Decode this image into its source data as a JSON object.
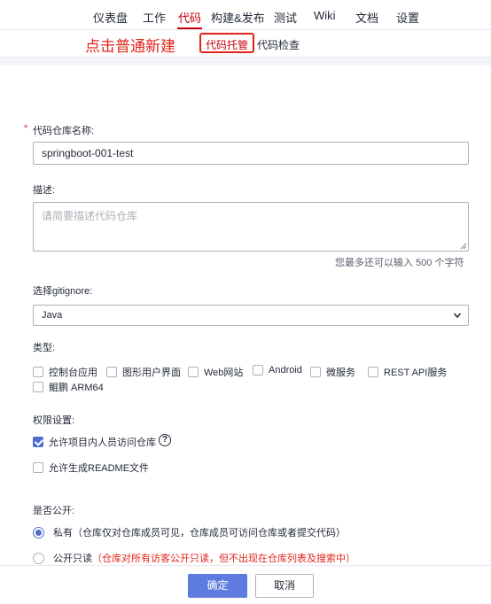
{
  "nav": {
    "items": [
      "仪表盘",
      "工作",
      "代码",
      "构建&发布",
      "测试",
      "Wiki",
      "文档",
      "设置"
    ],
    "active": "代码"
  },
  "annotation": "点击普通新建",
  "subnav": {
    "hosting": "代码托管",
    "check": "代码检查"
  },
  "form": {
    "name_label": "代码仓库名称:",
    "required_mark": "*",
    "name_value": "springboot-001-test",
    "desc_label": "描述:",
    "desc_placeholder": "请简要描述代码仓库",
    "desc_counter": "您最多还可以输入 500 个字符",
    "gitignore_label": "选择gitignore:",
    "gitignore_value": "Java",
    "type_label": "类型:",
    "types": [
      "控制台应用",
      "图形用户界面",
      "Web网站",
      "Android",
      "微服务",
      "REST API服务",
      "鲲鹏 ARM64"
    ],
    "perm_label": "权限设置:",
    "perm_allow_members": "允许项目内人员访问仓库",
    "perm_help": "?",
    "perm_readme": "允许生成README文件",
    "public_label": "是否公开:",
    "private_title": "私有",
    "private_desc": "（仓库仅对仓库成员可见，仓库成员可访问仓库或者提交代码）",
    "public_title": "公开只读",
    "public_desc": "（仓库对所有访客公开只读，但不出现在仓库列表及搜索中）"
  },
  "buttons": {
    "ok": "确定",
    "cancel": "取消"
  },
  "colors": {
    "brand_red": "#c7000b",
    "annotation_red": "#e2231a",
    "primary_blue": "#5e7ce0"
  },
  "icons": {
    "help": "question-circle-icon",
    "select": "chevron-down-icon",
    "check": "checkmark-icon"
  }
}
